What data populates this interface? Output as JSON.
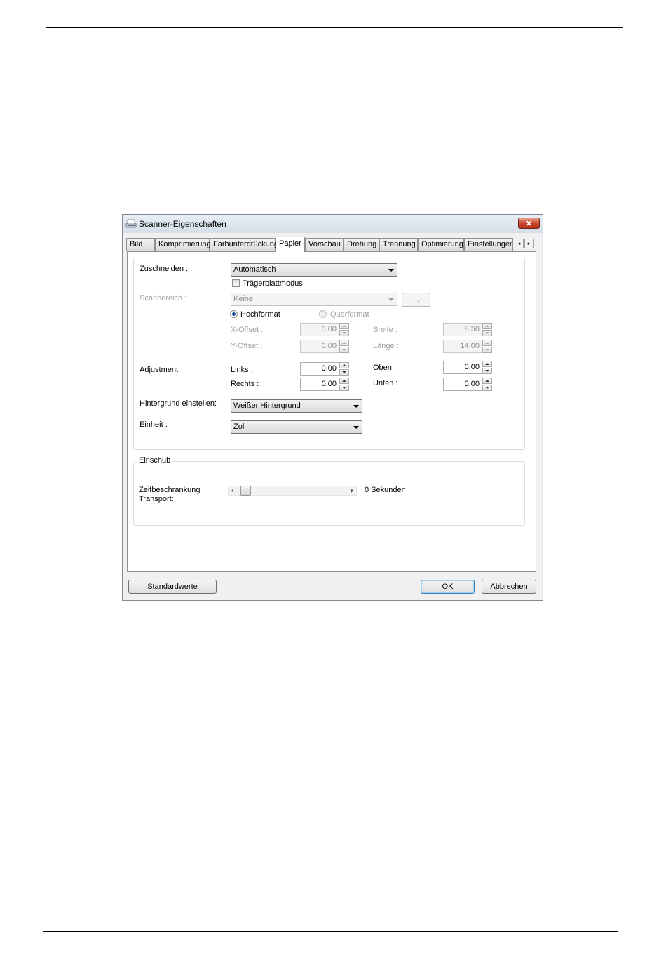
{
  "window": {
    "title": "Scanner-Eigenschaften",
    "close_glyph": "✕"
  },
  "tabs": [
    {
      "label": "Bild"
    },
    {
      "label": "Komprimierung"
    },
    {
      "label": "Farbunterdrückung"
    },
    {
      "label": "Papier",
      "active": true
    },
    {
      "label": "Vorschau"
    },
    {
      "label": "Drehung"
    },
    {
      "label": "Trennung"
    },
    {
      "label": "Optimierung"
    },
    {
      "label": "Einstellungen"
    }
  ],
  "paper": {
    "crop_label": "Zuschneiden :",
    "crop_value": "Automatisch",
    "carrier_label": "Trägerblattmodus",
    "scanarea_label": "Scanbereich :",
    "scanarea_value": "Keine",
    "scanarea_button": "...",
    "portrait_label": "Hochformat",
    "landscape_label": "Querformat",
    "xoffset_label": "X-Offset :",
    "xoffset_value": "0.00",
    "yoffset_label": "Y-Offset :",
    "yoffset_value": "0.00",
    "width_label": "Breite :",
    "width_value": "8.50",
    "length_label": "Länge :",
    "length_value": "14.00",
    "adjustment_label": "Adjustment:",
    "left_label": "Links :",
    "left_value": "0.00",
    "right_label": "Rechts :",
    "right_value": "0.00",
    "top_label": "Oben :",
    "top_value": "0.00",
    "bottom_label": "Unten :",
    "bottom_value": "0.00",
    "background_label": "Hintergrund einstellen:",
    "background_value": "Weißer Hintergrund",
    "unit_label": "Einheit :",
    "unit_value": "Zoll"
  },
  "feed": {
    "group_title": "Einschub",
    "timeout_label_line1": "Zeitbeschrankung",
    "timeout_label_line2": "Transport:",
    "timeout_value": "0 Sekunden",
    "timeout_level": 0
  },
  "buttons": {
    "defaults": "Standardwerte",
    "ok": "OK",
    "cancel": "Abbrechen"
  }
}
